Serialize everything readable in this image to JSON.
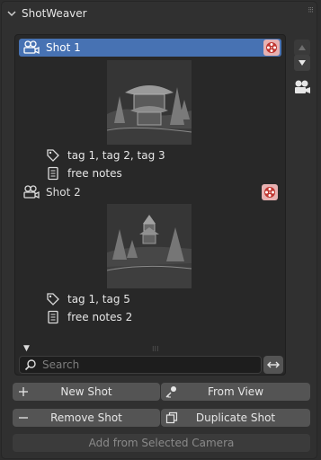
{
  "panel": {
    "title": "ShotWeaver"
  },
  "shots": [
    {
      "name": "Shot 1",
      "tags": "tag 1, tag 2, tag 3",
      "notes": "free notes",
      "active": true
    },
    {
      "name": "Shot 2",
      "tags": "tag 1, tag 5",
      "notes": "free notes 2",
      "active": false
    }
  ],
  "search": {
    "placeholder": "Search",
    "value": ""
  },
  "buttons": {
    "new_shot": "New Shot",
    "from_view": "From View",
    "remove_shot": "Remove Shot",
    "duplicate_shot": "Duplicate Shot",
    "add_from_camera": "Add from Selected Camera"
  },
  "colors": {
    "active_row": "#4772b3",
    "render_button": "#e7b1b1",
    "render_icon": "#c0352f"
  }
}
